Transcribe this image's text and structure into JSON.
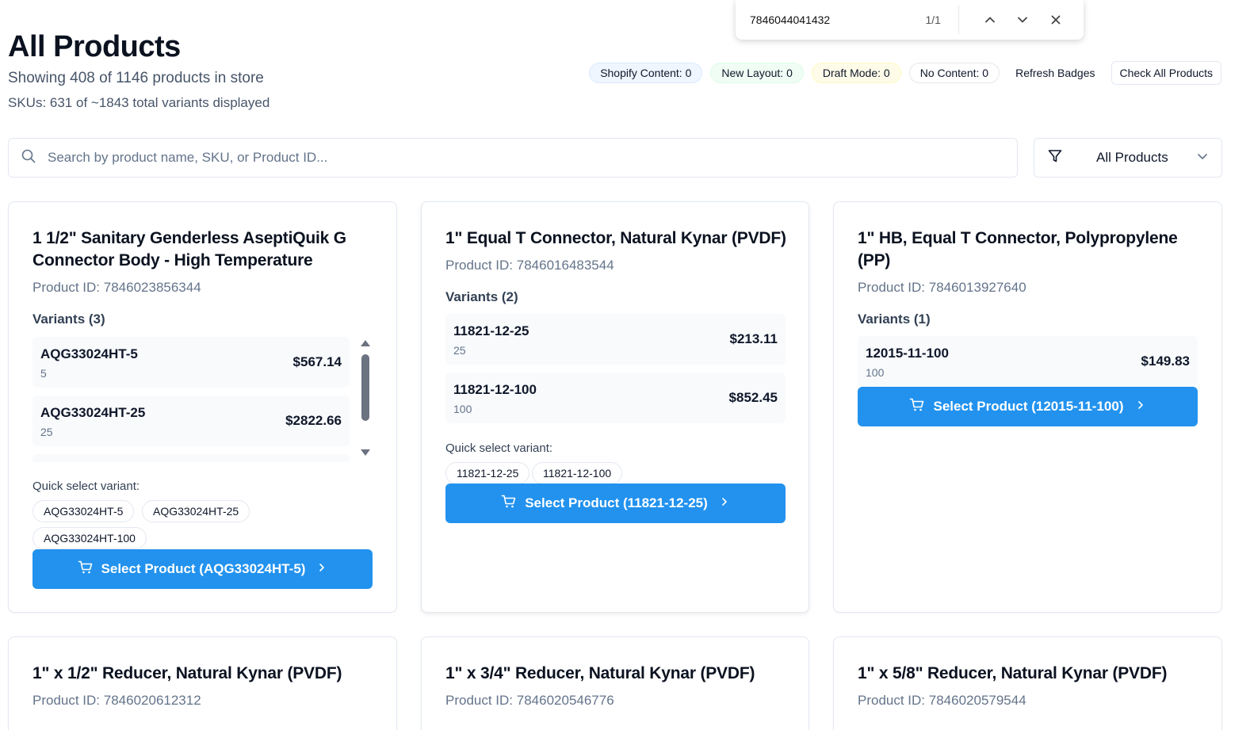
{
  "header": {
    "title": "All Products",
    "subtitle": "Showing 408 of 1146 products in store",
    "skus": "SKUs: 631 of ~1843 total variants displayed"
  },
  "badges": {
    "shopify": "Shopify Content: 0",
    "new_layout": "New Layout: 0",
    "draft": "Draft Mode: 0",
    "no_content": "No Content: 0",
    "refresh": "Refresh Badges",
    "check_all": "Check All Products"
  },
  "find": {
    "query": "7846044041432",
    "count": "1/1"
  },
  "search": {
    "placeholder": "Search by product name, SKU, or Product ID..."
  },
  "filter": {
    "selected": "All Products"
  },
  "cards": [
    {
      "title": "1 1/2\" Sanitary Genderless AseptiQuik G Connector Body - High Temperature",
      "pid": "Product ID: 7846023856344",
      "variants_header": "Variants (3)",
      "variants": [
        {
          "sku": "AQG33024HT-5",
          "qty": "5",
          "price": "$567.14"
        },
        {
          "sku": "AQG33024HT-25",
          "qty": "25",
          "price": "$2822.66"
        }
      ],
      "quick_label": "Quick select variant:",
      "chips": [
        "AQG33024HT-5",
        "AQG33024HT-25",
        "AQG33024HT-100"
      ],
      "select_label": "Select Product (AQG33024HT-5)"
    },
    {
      "title": "1\" Equal T Connector, Natural Kynar (PVDF)",
      "pid": "Product ID: 7846016483544",
      "variants_header": "Variants (2)",
      "variants": [
        {
          "sku": "11821-12-25",
          "qty": "25",
          "price": "$213.11"
        },
        {
          "sku": "11821-12-100",
          "qty": "100",
          "price": "$852.45"
        }
      ],
      "quick_label": "Quick select variant:",
      "chips": [
        "11821-12-25",
        "11821-12-100"
      ],
      "select_label": "Select Product (11821-12-25)"
    },
    {
      "title": "1\" HB, Equal T Connector, Polypropylene (PP)",
      "pid": "Product ID: 7846013927640",
      "variants_header": "Variants (1)",
      "variants": [
        {
          "sku": "12015-11-100",
          "qty": "100",
          "price": "$149.83"
        }
      ],
      "select_label": "Select Product (12015-11-100)"
    },
    {
      "title": "1\" x 1/2\" Reducer, Natural Kynar (PVDF)",
      "pid": "Product ID: 7846020612312"
    },
    {
      "title": "1\" x 3/4\" Reducer, Natural Kynar (PVDF)",
      "pid": "Product ID: 7846020546776"
    },
    {
      "title": "1\" x 5/8\" Reducer, Natural Kynar (PVDF)",
      "pid": "Product ID: 7846020579544"
    }
  ]
}
